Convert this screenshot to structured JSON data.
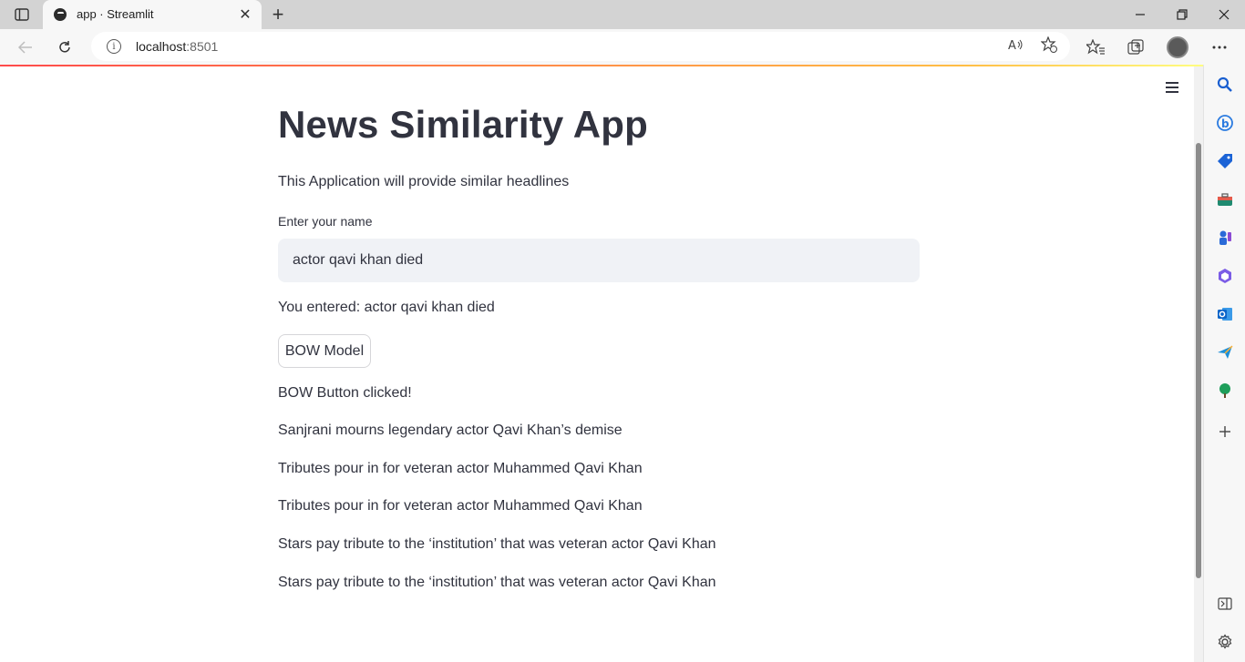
{
  "browser": {
    "tab_title": "app · Streamlit",
    "url_host": "localhost",
    "url_port": ":8501",
    "tab_close": "✕",
    "new_tab": "+"
  },
  "app": {
    "title": "News Similarity App",
    "subtitle": "This Application will provide similar headlines",
    "input_label": "Enter your name",
    "input_value": "actor qavi khan died",
    "entered_text": "You entered: actor qavi khan died",
    "bow_button_label": "BOW Model",
    "clicked_text": "BOW Button clicked!",
    "results": [
      "Sanjrani mourns legendary actor Qavi Khan’s demise",
      "Tributes pour in for veteran actor Muhammed Qavi Khan",
      "Tributes pour in for veteran actor Muhammed Qavi Khan",
      "Stars pay tribute to the ‘institution’ that was veteran actor Qavi Khan",
      "Stars pay tribute to the ‘institution’ that was veteran actor Qavi Khan"
    ]
  },
  "colors": {
    "text": "#31333f",
    "input_bg": "#f0f2f6",
    "accent_red": "#ff4b4b",
    "accent_yellow": "#ffbd45"
  }
}
